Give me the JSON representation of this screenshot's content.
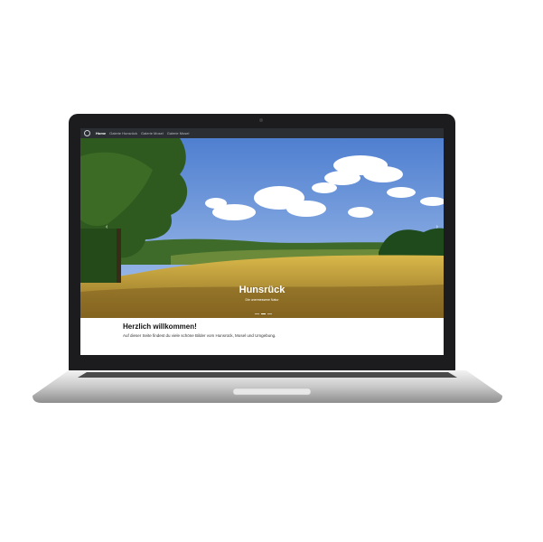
{
  "nav": {
    "items": [
      {
        "label": "Home",
        "active": true
      },
      {
        "label": "Galerie Hunsrück",
        "active": false
      },
      {
        "label": "Galerie Mosel",
        "active": false
      },
      {
        "label": "Galerie Mosel",
        "active": false
      }
    ]
  },
  "hero": {
    "title": "Hunsrück",
    "subtitle": "Die unermessene Natur",
    "slide_count": 3,
    "active_slide": 2
  },
  "content": {
    "heading": "Herzlich willkommen!",
    "text": "Auf dieser Seite findest du viele schöne Bilder vom Hunsrück, Mosel und Umgebung."
  },
  "colors": {
    "navbar": "#2b2f33",
    "sky": "#6f98d8",
    "field": "#c9a43a"
  }
}
